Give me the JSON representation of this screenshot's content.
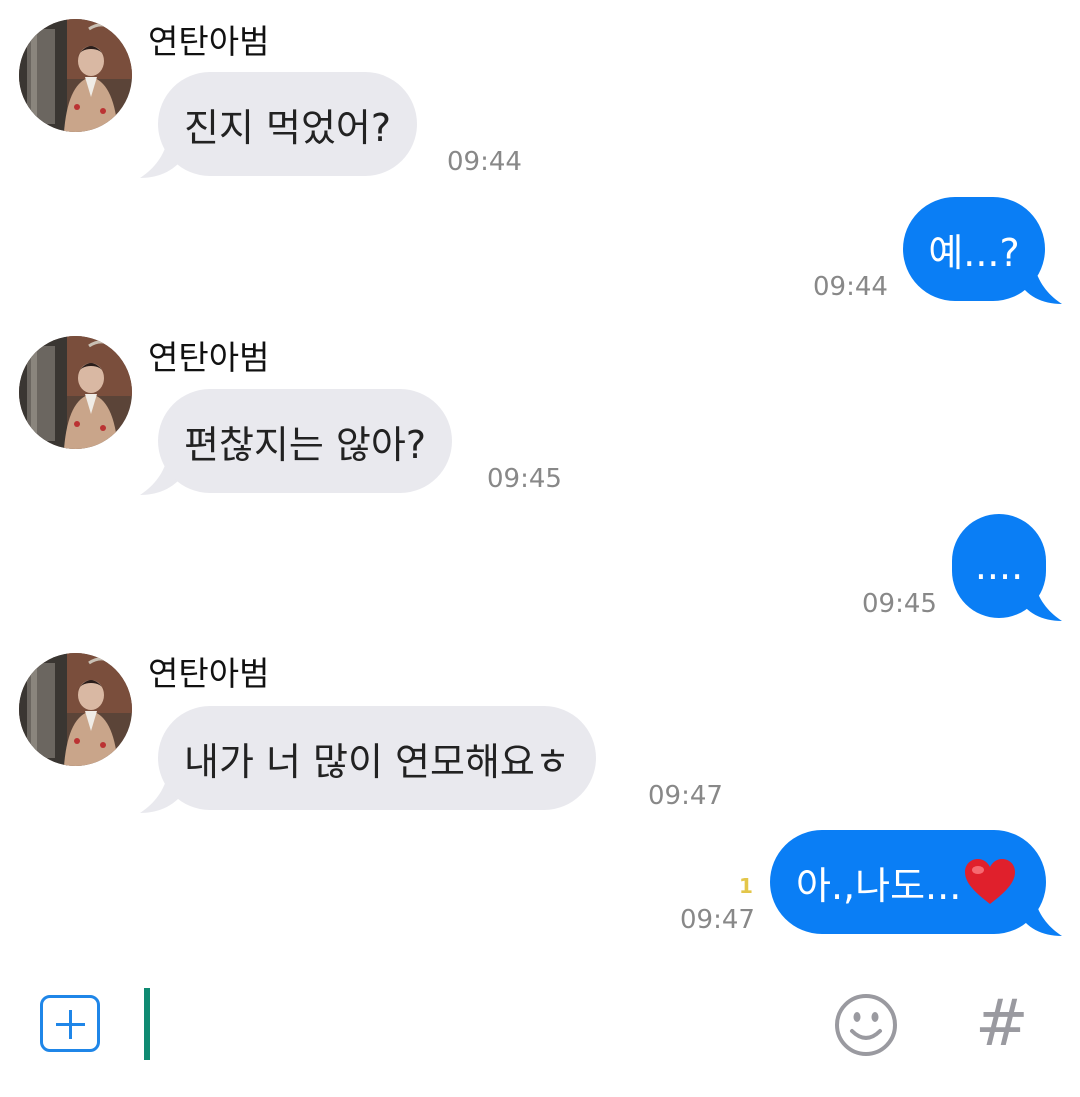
{
  "conversation": {
    "messages": [
      {
        "id": 1,
        "direction": "incoming",
        "sender": "연탄아범",
        "text": "진지 먹었어?",
        "time": "09:44"
      },
      {
        "id": 2,
        "direction": "outgoing",
        "text": "예...?",
        "time": "09:44"
      },
      {
        "id": 3,
        "direction": "incoming",
        "sender": "연탄아범",
        "text": "편찮지는 않아?",
        "time": "09:45"
      },
      {
        "id": 4,
        "direction": "outgoing",
        "text": "....",
        "time": "09:45"
      },
      {
        "id": 5,
        "direction": "incoming",
        "sender": "연탄아범",
        "text": "내가 너 많이 연모해요ㅎ",
        "time": "09:47"
      },
      {
        "id": 6,
        "direction": "outgoing",
        "text": "아.,나도...",
        "emoji": "heart-icon",
        "unread_count": "1",
        "time": "09:47"
      }
    ]
  },
  "composer": {
    "add_icon": "plus-square-icon",
    "emoji_icon": "smiley-icon",
    "hashtag_label": "#"
  },
  "colors": {
    "outgoing_bubble": "#0a7ef5",
    "incoming_bubble": "#e9e9ee",
    "timestamp": "#888888",
    "unread": "#e3c64a",
    "cursor": "#0f8a72",
    "add_button": "#1f86e8"
  }
}
